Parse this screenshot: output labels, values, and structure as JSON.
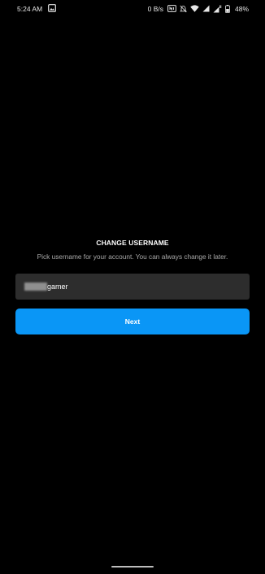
{
  "status_bar": {
    "time": "5:24 AM",
    "net_speed": "0 B/s",
    "battery": "48%",
    "icons": [
      "gallery-icon",
      "nfc-icon",
      "mute-icon",
      "wifi-icon",
      "signal-icon",
      "signal-icon-2",
      "battery-icon"
    ]
  },
  "screen": {
    "title": "CHANGE USERNAME",
    "subtitle": "Pick username for your account. You can always change it later."
  },
  "username_input": {
    "value_suffix": "gamer"
  },
  "next_button": {
    "label": "Next"
  },
  "colors": {
    "background": "#000000",
    "input_bg": "#2d2d2d",
    "accent": "#0a96f6"
  }
}
